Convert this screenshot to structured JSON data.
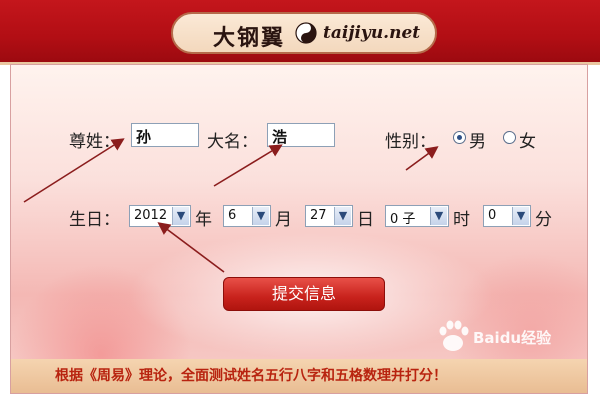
{
  "header": {
    "logo_calligraphy": "大钢翼",
    "logo_domain": "taijiyu.net"
  },
  "form": {
    "surname_label": "尊姓：",
    "surname_value": "孙",
    "givenname_label": "大名：",
    "givenname_value": "浩",
    "gender_label": "性别：",
    "gender_options": [
      {
        "label": "男",
        "selected": true
      },
      {
        "label": "女",
        "selected": false
      }
    ],
    "birthday_label": "生日：",
    "year_value": "2012",
    "year_unit": "年",
    "month_value": "6",
    "month_unit": "月",
    "day_value": "27",
    "day_unit": "日",
    "hour_value": "0 子",
    "hour_unit": "时",
    "minute_value": "0",
    "minute_unit": "分",
    "submit_label": "提交信息"
  },
  "footer": {
    "text": "根据《周易》理论，全面测试姓名五行八字和五格数理并打分！"
  },
  "watermark": {
    "text": "Baidu经验"
  },
  "colors": {
    "header_red": "#c4161c",
    "arrow": "#8b1d1d",
    "footer_text": "#b8230f"
  }
}
